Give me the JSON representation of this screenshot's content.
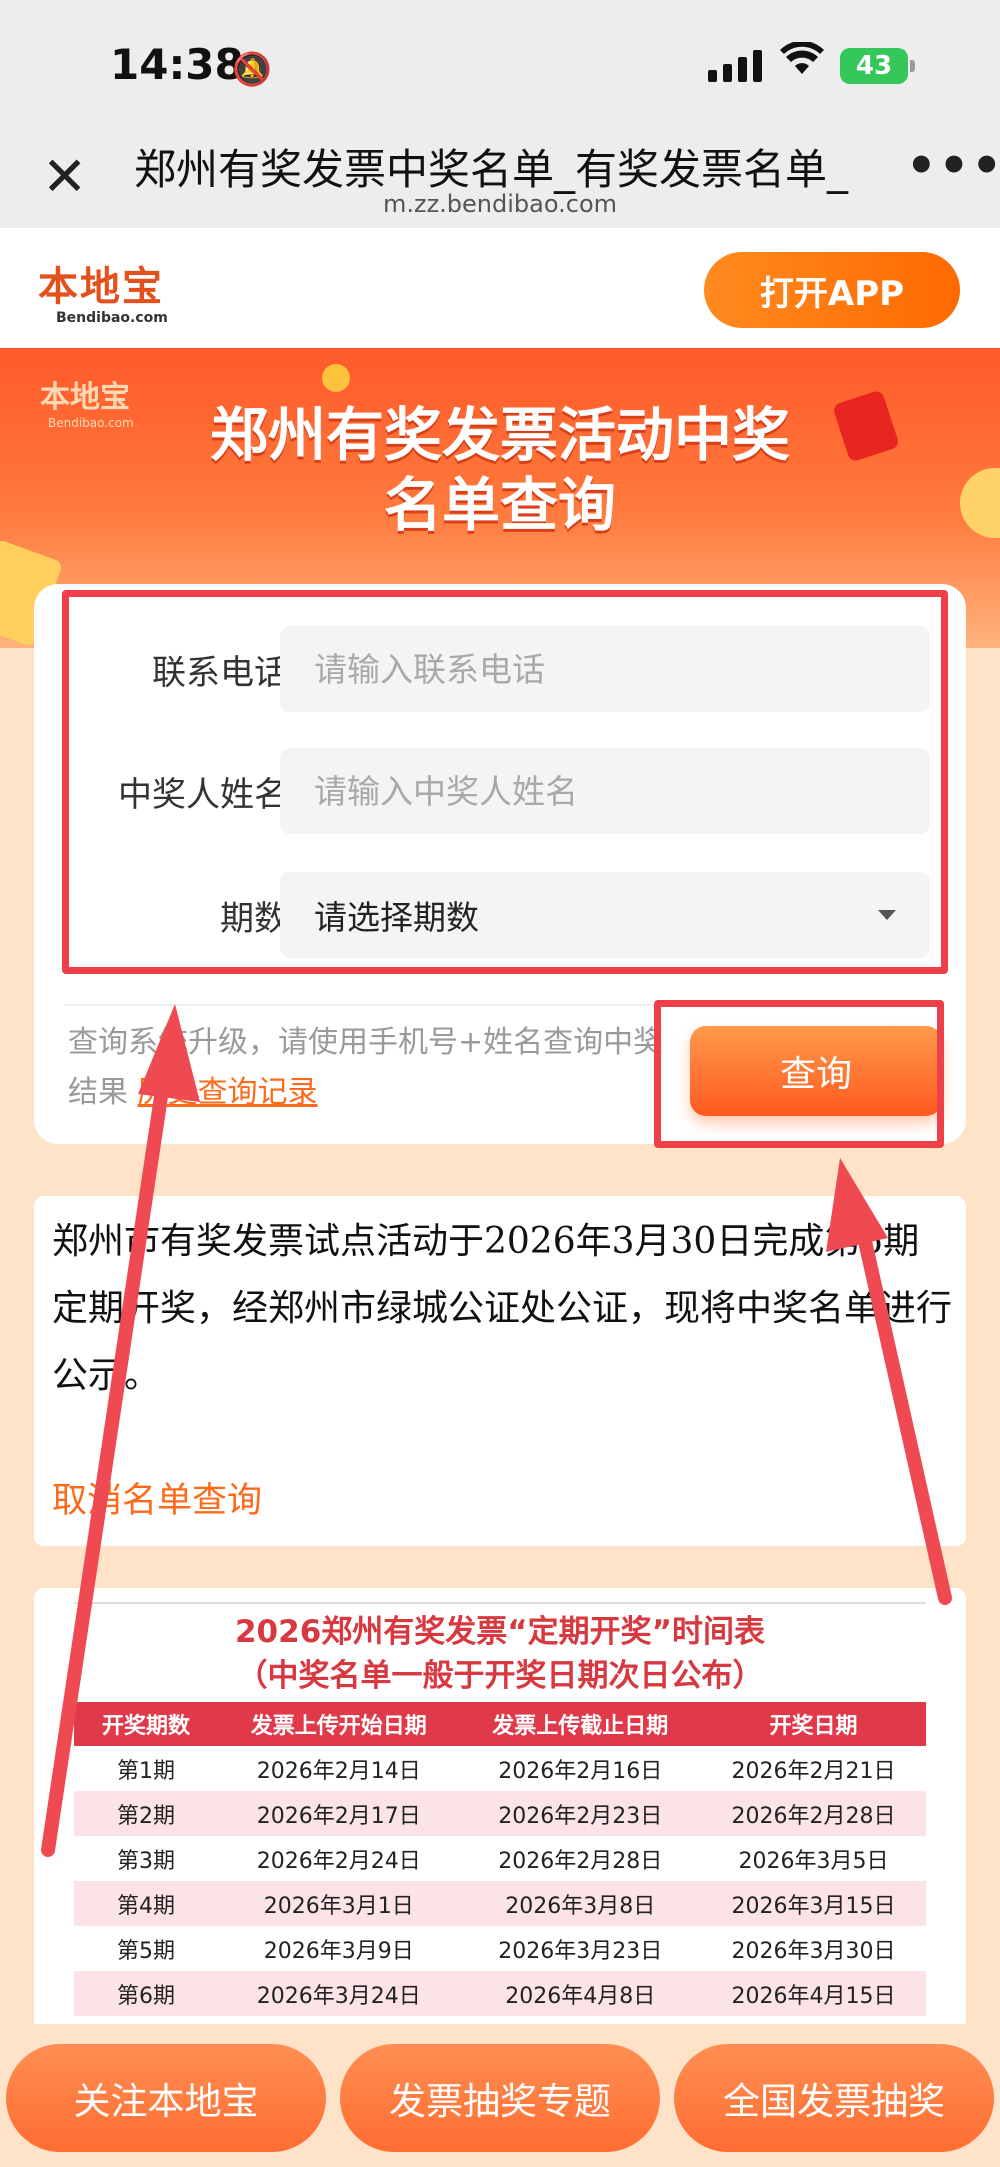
{
  "status_bar": {
    "time": "14:38",
    "battery": "43"
  },
  "browser": {
    "title": "郑州有奖发票中奖名单_有奖发票名单_",
    "url": "m.zz.bendibao.com"
  },
  "site": {
    "logo_text": "本地宝",
    "logo_sub": "Bendibao.com",
    "open_app": "打开APP"
  },
  "banner": {
    "title_line1": "郑州有奖发票活动中奖",
    "title_line2": "名单查询",
    "logo_text": "本地宝",
    "logo_sub": "Bendibao.com"
  },
  "form": {
    "phone_label": "联系电话",
    "phone_placeholder": "请输入联系电话",
    "name_label": "中奖人姓名",
    "name_placeholder": "请输入中奖人姓名",
    "period_label": "期数",
    "period_value": "请选择期数",
    "hint_text": "查询系统升级，请使用手机号+姓名查询中奖结果 ",
    "history_link": "历史查询记录",
    "query_button": "查询"
  },
  "notice": {
    "text": "郑州市有奖发票试点活动于2026年3月30日完成第5期定期开奖，经郑州市绿城公证处公证，现将中奖名单进行公示。",
    "cancel_link": "取消名单查询"
  },
  "schedule": {
    "title_line1": "2026郑州有奖发票“定期开奖”时间表",
    "title_line2": "（中奖名单一般于开奖日期次日公布）",
    "headers": [
      "开奖期数",
      "发票上传开始日期",
      "发票上传截止日期",
      "开奖日期"
    ],
    "rows": [
      [
        "第1期",
        "2026年2月14日",
        "2026年2月16日",
        "2026年2月21日"
      ],
      [
        "第2期",
        "2026年2月17日",
        "2026年2月23日",
        "2026年2月28日"
      ],
      [
        "第3期",
        "2026年2月24日",
        "2026年2月28日",
        "2026年3月5日"
      ],
      [
        "第4期",
        "2026年3月1日",
        "2026年3月8日",
        "2026年3月15日"
      ],
      [
        "第5期",
        "2026年3月9日",
        "2026年3月23日",
        "2026年3月30日"
      ],
      [
        "第6期",
        "2026年3月24日",
        "2026年4月8日",
        "2026年4月15日"
      ]
    ]
  },
  "bottom_bar": {
    "btn1": "关注本地宝",
    "btn2": "发票抽奖专题",
    "btn3": "全国发票抽奖"
  },
  "colors": {
    "brand_orange": "#ff6a1a",
    "annotation_red": "#ef3f48",
    "table_header": "#e0394a"
  }
}
